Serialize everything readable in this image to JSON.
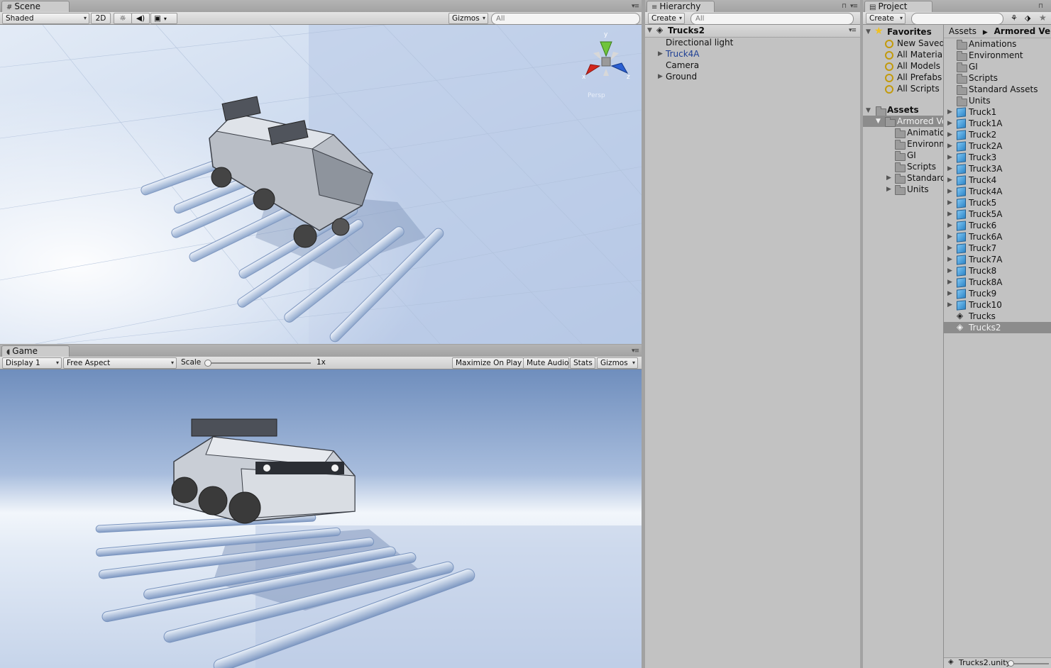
{
  "scene": {
    "tab": "Scene",
    "shading": "Shaded",
    "mode2d": "2D",
    "gizmos": "Gizmos",
    "search_placeholder": "All",
    "axis_labels": {
      "y": "y",
      "x": "x",
      "z": "z"
    },
    "persp_label": "Persp"
  },
  "game": {
    "tab": "Game",
    "display": "Display 1",
    "aspect": "Free Aspect",
    "scale_label": "Scale",
    "scale_value": "1x",
    "maximize": "Maximize On Play",
    "mute": "Mute Audio",
    "stats": "Stats",
    "gizmos": "Gizmos"
  },
  "hierarchy": {
    "tab": "Hierarchy",
    "create": "Create",
    "search_placeholder": "All",
    "root": "Trucks2",
    "items": [
      {
        "label": "Directional light",
        "expandable": false,
        "color": "#111111"
      },
      {
        "label": "Truck4A",
        "expandable": true,
        "color": "#1e3f94"
      },
      {
        "label": "Camera",
        "expandable": false,
        "color": "#111111"
      },
      {
        "label": "Ground",
        "expandable": true,
        "color": "#111111"
      }
    ]
  },
  "project": {
    "tab": "Project",
    "create": "Create",
    "favorites_label": "Favorites",
    "favorites": [
      "New Saved",
      "All Materials",
      "All Models",
      "All Prefabs",
      "All Scripts"
    ],
    "assets_label": "Assets",
    "tree_selected": "Armored Vehicles",
    "tree_children": [
      {
        "label": "Animations",
        "expandable": false
      },
      {
        "label": "Environment",
        "expandable": false
      },
      {
        "label": "GI",
        "expandable": false
      },
      {
        "label": "Scripts",
        "expandable": false
      },
      {
        "label": "Standard Assets",
        "expandable": true
      },
      {
        "label": "Units",
        "expandable": true
      }
    ],
    "breadcrumb": [
      "Assets",
      "Armored Vehicles"
    ],
    "folders": [
      "Animations",
      "Environment",
      "GI",
      "Scripts",
      "Standard Assets",
      "Units"
    ],
    "prefabs": [
      "Truck1",
      "Truck1A",
      "Truck2",
      "Truck2A",
      "Truck3",
      "Truck3A",
      "Truck4",
      "Truck4A",
      "Truck5",
      "Truck5A",
      "Truck6",
      "Truck6A",
      "Truck7",
      "Truck7A",
      "Truck8",
      "Truck8A",
      "Truck9",
      "Truck10"
    ],
    "scenes": [
      "Trucks",
      "Trucks2"
    ],
    "selected_scene": "Trucks2",
    "status_file": "Trucks2.unity"
  },
  "colors": {
    "sky_top": "#6f8ebd",
    "sky_horizon": "#f2f6fb",
    "ground": "#c9d7ec",
    "selection": "#8c8c8c"
  }
}
